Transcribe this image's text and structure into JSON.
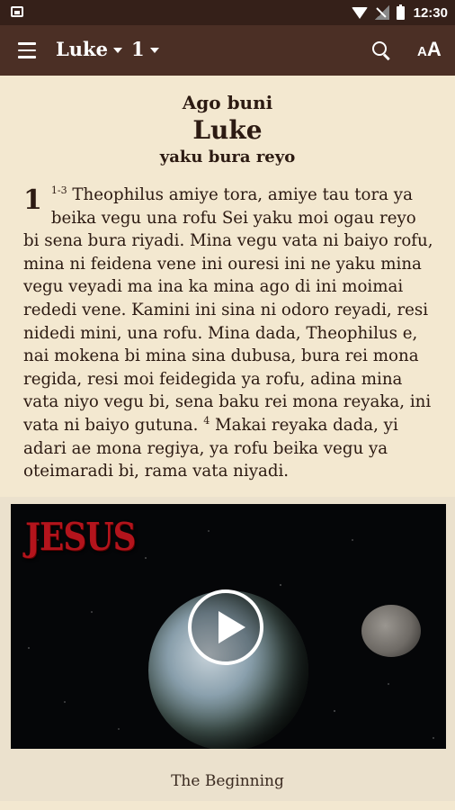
{
  "status_bar": {
    "time": "12:30",
    "icons": [
      "image-icon",
      "wifi-icon",
      "signal-off-icon",
      "battery-icon"
    ]
  },
  "toolbar": {
    "menu_icon": "hamburger-menu-icon",
    "book": "Luke",
    "chapter": "1",
    "search_icon": "search-icon",
    "text_size_icon": "text-size-icon",
    "text_size_small": "A",
    "text_size_big": "A"
  },
  "heading": {
    "intro": "Ago buni",
    "book_title": "Luke",
    "subtitle": "yaku bura reyo"
  },
  "passage": {
    "chapter_number": "1",
    "verse_ref_1": "1-3",
    "text_1": "Theophilus amiye tora, amiye tau tora ya beika vegu una rofu Sei yaku moi ogau reyo bi sena bura riyadi. Mina vegu vata ni baiyo rofu, mina ni feidena vene ini ouresi ini ne yaku mina vegu veyadi ma ina ka mina ago di ini moimai rededi vene. Kamini ini sina ni odoro reyadi, resi nidedi mini, una rofu. Mina dada, Theophilus e, nai mokena bi mina sina dubusa, bura rei mona regida, resi moi feidegida ya rofu, adina mina vata niyo vegu bi, sena baku rei mona reyaka, ini vata ni baiyo gutuna.",
    "verse_ref_2": "4",
    "text_2": "Makai reyaka dada, yi adari ae mona regiya, ya rofu beika vegu ya oteimaradi bi, rama vata niyadi."
  },
  "video": {
    "logo_text": "JESUS",
    "play_icon": "play-icon",
    "title": "The Beginning"
  },
  "colors": {
    "status_bar": "#352019",
    "app_bar": "#4b2f25",
    "page_background": "#f3e8d0",
    "text": "#2c1a12"
  }
}
